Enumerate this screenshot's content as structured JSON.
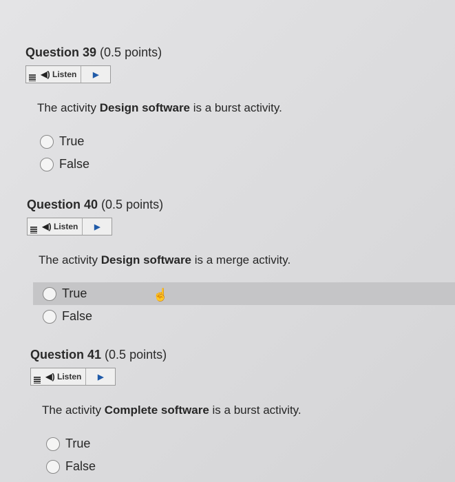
{
  "questions": [
    {
      "number_label": "Question 39",
      "points": "(0.5 points)",
      "listen_label": "Listen",
      "text_prefix": "The activity ",
      "text_bold": "Design software",
      "text_suffix": " is a burst activity.",
      "options": [
        "True",
        "False"
      ]
    },
    {
      "number_label": "Question 40",
      "points": "(0.5 points)",
      "listen_label": "Listen",
      "text_prefix": "The activity ",
      "text_bold": "Design software",
      "text_suffix": " is a merge activity.",
      "options": [
        "True",
        "False"
      ]
    },
    {
      "number_label": "Question 41",
      "points": "(0.5 points)",
      "listen_label": "Listen",
      "text_prefix": "The activity ",
      "text_bold": "Complete software",
      "text_suffix": " is a burst activity.",
      "options": [
        "True",
        "False"
      ]
    }
  ],
  "colors": {
    "background": "#dcdcde",
    "hover_row": "#c5c5c7",
    "play_icon": "#1f5aa8"
  },
  "icons": {
    "menu": "menu-icon",
    "speaker": "speaker-icon",
    "play": "play-icon",
    "cursor": "hand-pointer-icon"
  }
}
